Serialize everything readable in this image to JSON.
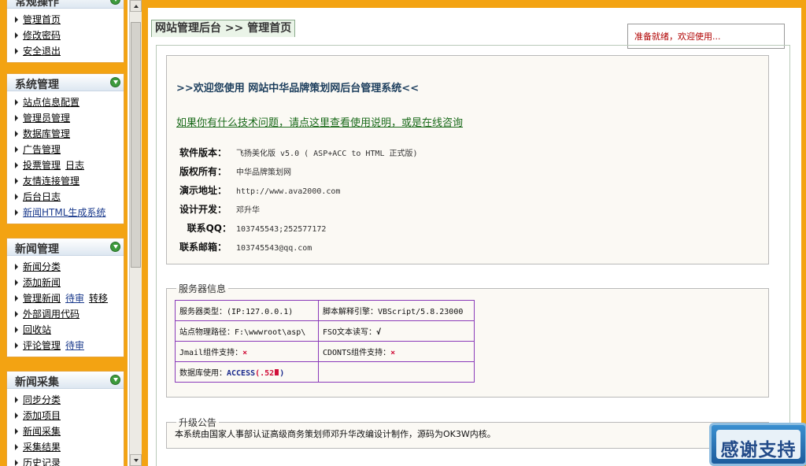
{
  "sidebar": {
    "menus": [
      {
        "title": "常规操作",
        "items": [
          "管理首页",
          "修改密码",
          "安全退出"
        ]
      },
      {
        "title": "系统管理",
        "items": [
          "站点信息配置",
          "管理员管理",
          "数据库管理",
          "广告管理",
          "投票管理",
          "友情连接管理",
          "后台日志",
          "新闻HTML生成系统"
        ],
        "vote_sub": "日志"
      },
      {
        "title": "新闻管理",
        "items": [
          "新闻分类",
          "添加新闻",
          "管理新闻",
          "外部调用代码",
          "回收站",
          "评论管理"
        ],
        "manage_subs": [
          "待审",
          "转移"
        ],
        "comment_sub": "待审"
      },
      {
        "title": "新闻采集",
        "items": [
          "同步分类",
          "添加项目",
          "新闻采集",
          "采集结果",
          "历史记录"
        ]
      }
    ]
  },
  "main": {
    "breadcrumb": "网站管理后台 >> 管理首页",
    "status": "准备就绪，欢迎使用...",
    "welcome_title": ">>欢迎您使用 网站中华品牌策划网后台管理系统<<",
    "help_link": "如果你有什么技术问题，请点这里查看使用说明，或是在线咨询",
    "info": {
      "version_label": "软件版本：",
      "version_value": "飞扬美化版 v5.0 ( ASP+ACC to HTML 正式版)",
      "copyright_label": "版权所有：",
      "copyright_value": "中华品牌策划网",
      "demo_label": "演示地址：",
      "demo_value": "http://www.ava2000.com",
      "dev_label": "设计开发：",
      "dev_value": "邓升华",
      "qq_label": "联系QQ：",
      "qq_value": "103745543;252577172",
      "email_label": "联系邮箱：",
      "email_value": "103745543@qq.com"
    },
    "server": {
      "legend": "服务器信息",
      "server_type": "服务器类型：(IP:127.0.0.1)",
      "script_engine": "脚本解释引擎：VBScript/5.8.23000",
      "phys_path": "站点物理路径：F:\\wwwroot\\asp\\",
      "fso_label": "FSO文本读写：",
      "fso_mark": "√",
      "jmail_label": "Jmail组件支持：",
      "jmail_mark": "×",
      "cdonts_label": "CDONTS组件支持：",
      "cdonts_mark": "×",
      "db_label": "数据库使用：",
      "db_value": "ACCESS",
      "db_size": "(.52",
      "db_close": ")"
    },
    "notice": {
      "legend": "升级公告",
      "text": "本系统由国家人事部认证高级商务策划师邓升华改编设计制作，源码为OK3W内核。"
    },
    "thanks": "感谢支持"
  },
  "colors": {
    "frame_orange": "#f3a312",
    "panel_bg": "#fbf9f4",
    "table_border": "#8a3ab9",
    "status_red": "#b00000",
    "x_red": "#d0103a"
  }
}
